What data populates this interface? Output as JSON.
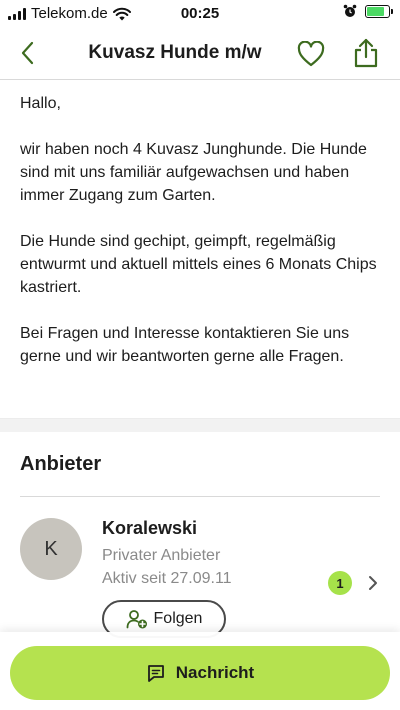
{
  "status_bar": {
    "carrier": "Telekom.de",
    "time": "00:25",
    "signal_bars": 4,
    "battery_level": 0.8,
    "icons": [
      "signal-icon",
      "wifi-icon",
      "alarm-icon",
      "battery-icon"
    ]
  },
  "header": {
    "title": "Kuvasz Hunde m/w",
    "icons": [
      "back-icon",
      "heart-icon",
      "share-icon"
    ]
  },
  "description": {
    "paragraphs": [
      "Hallo,",
      "wir haben noch 4 Kuvasz Junghunde. Die Hunde sind mit uns familiär aufgewachsen und haben immer Zugang zum Garten.",
      "Die Hunde sind gechipt, geimpft, regelmäßig entwurmt und aktuell mittels eines 6 Monats Chips kastriert.",
      "Bei Fragen und Interesse kontaktieren Sie uns gerne und wir beantworten gerne alle Fragen."
    ]
  },
  "seller": {
    "section_title": "Anbieter",
    "avatar_initial": "K",
    "name": "Koralewski",
    "type": "Privater Anbieter",
    "active_since": "Aktiv seit 27.09.11",
    "badge_count": "1",
    "follow_label": "Folgen"
  },
  "bottom": {
    "message_label": "Nachricht"
  },
  "colors": {
    "accent": "#b5e24f",
    "icon_green": "#3d6b1f",
    "badge": "#a6e24a",
    "muted_text": "#8a8a8a"
  }
}
